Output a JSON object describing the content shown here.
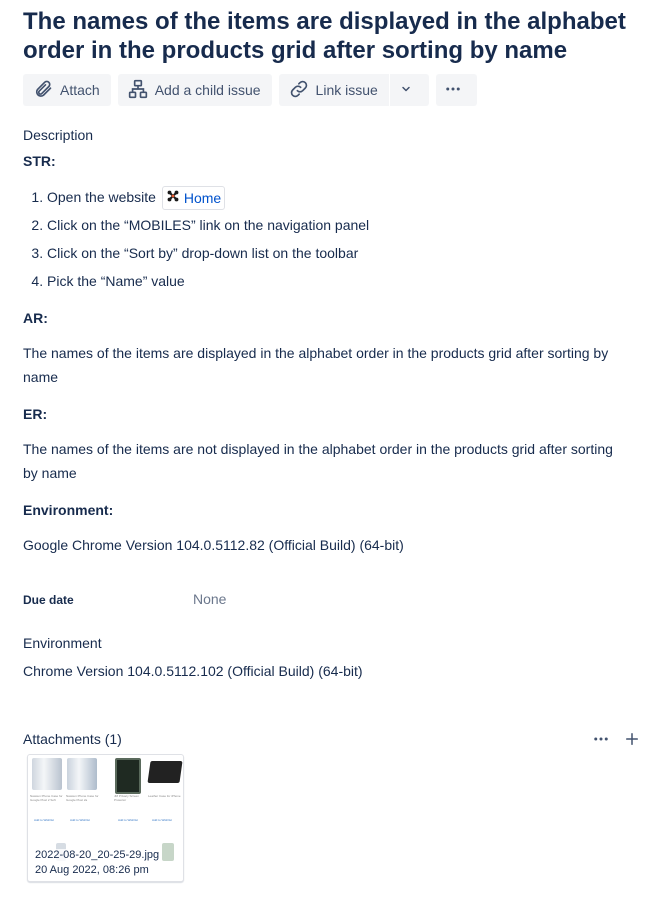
{
  "issue": {
    "title": "The names of the items are displayed in the alphabet order in the products grid after sorting by name"
  },
  "toolbar": {
    "attach_label": "Attach",
    "child_issue_label": "Add a child issue",
    "link_issue_label": "Link issue"
  },
  "description": {
    "heading": "Description",
    "str_label": "STR:",
    "steps": [
      "Open the website",
      "Click on the “MOBILES” link on the navigation panel",
      "Click on the “Sort by” drop-down list on the toolbar",
      "Pick the “Name” value"
    ],
    "home_link": "Home",
    "ar_label": "AR:",
    "ar_text": "The names of the items are displayed in the alphabet order in the products grid after sorting by name",
    "er_label": "ER:",
    "er_text": "The names of the items are not displayed in the alphabet order in the products grid after sorting by name",
    "env_label": "Environment:",
    "env_text": "Google Chrome Version 104.0.5112.82 (Official Build) (64-bit)"
  },
  "fields": {
    "due_date_label": "Due date",
    "due_date_value": "None",
    "environment_label": "Environment",
    "environment_value": "Chrome Version 104.0.5112.102 (Official Build) (64-bit)"
  },
  "attachments": {
    "heading": "Attachments (1)",
    "items": [
      {
        "filename": "2022-08-20_20-25-29.jpg",
        "date": "20 Aug 2022, 08:26 pm"
      }
    ]
  },
  "icons": {
    "attach": "paperclip-icon",
    "child_issue": "hierarchy-icon",
    "link_issue": "link-icon",
    "dropdown": "chevron-down-icon",
    "more": "more-horizontal-icon",
    "home_favicon": "joomla-icon",
    "add": "plus-icon"
  }
}
